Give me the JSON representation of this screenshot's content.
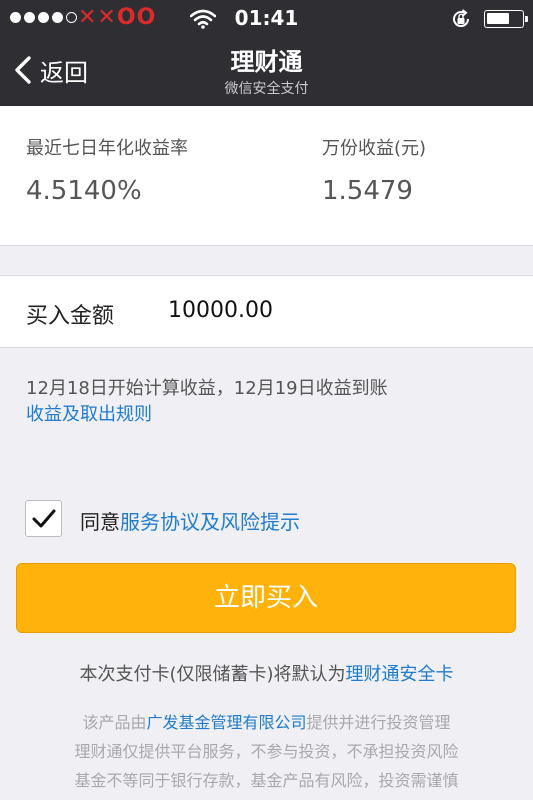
{
  "status_bar": {
    "carrier": "✕✕OO",
    "time": "01:41"
  },
  "nav": {
    "back_label": "返回",
    "title": "理财通",
    "subtitle": "微信安全支付"
  },
  "yield": {
    "annualized_label": "最近七日年化收益率",
    "annualized_value": "4.5140%",
    "per_10k_label": "万份收益(元)",
    "per_10k_value": "1.5479"
  },
  "purchase": {
    "amount_label": "买入金额",
    "amount_value": "10000.00",
    "schedule_text": "12月18日开始计算收益，12月19日收益到账",
    "rules_link": "收益及取出规则"
  },
  "agreement": {
    "checked": true,
    "prefix": "同意",
    "link": "服务协议及风险提示"
  },
  "buy_button": "立即买入",
  "card_note": {
    "text": "本次支付卡(仅限储蓄卡)将默认为",
    "link": "理财通安全卡"
  },
  "disclaimer": {
    "line1_prefix": "该产品由",
    "line1_link": "广发基金管理有限公司",
    "line1_suffix": "提供并进行投资管理",
    "line2": "理财通仅提供平台服务，不参与投资，不承担投资风险",
    "line3": "基金不等同于银行存款，基金产品有风险，投资需谨慎"
  },
  "colors": {
    "nav_bg": "#2e2e33",
    "accent_orange": "#ffb20b",
    "link_blue": "#1f7ccf"
  }
}
